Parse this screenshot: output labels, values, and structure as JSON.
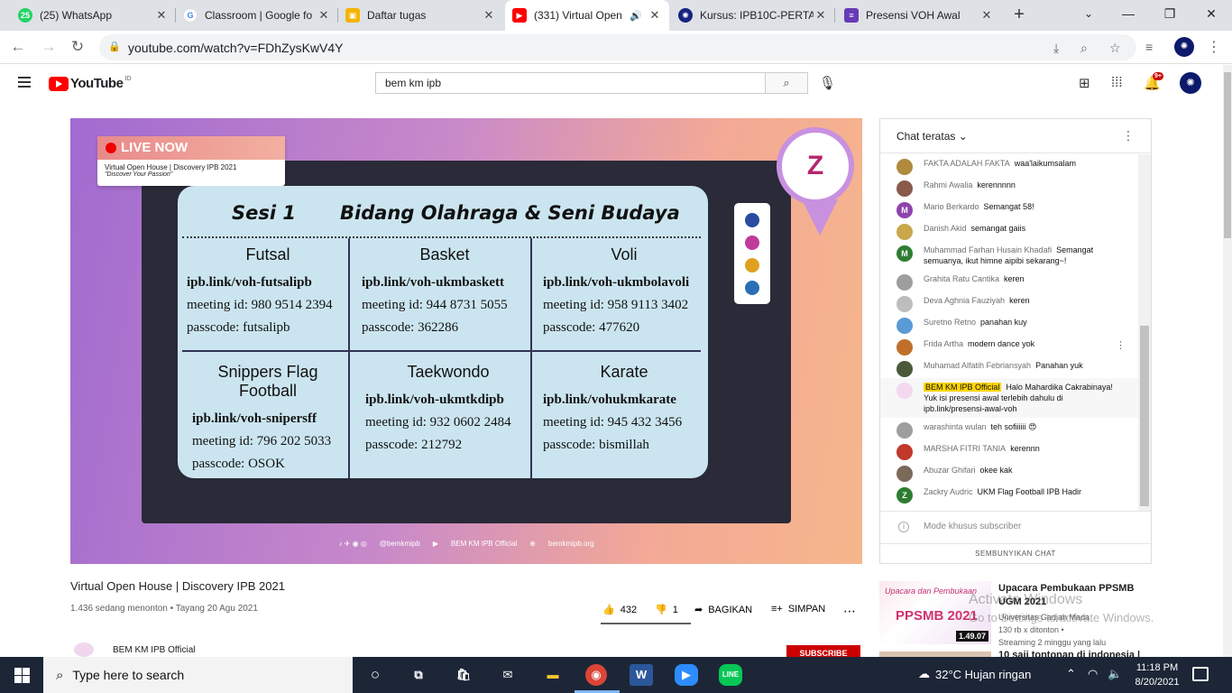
{
  "browser": {
    "tabs": [
      {
        "title": "(25) WhatsApp",
        "favicon": "whatsapp-icon",
        "badge": "25"
      },
      {
        "title": "Classroom | Google fo",
        "favicon": "google-icon"
      },
      {
        "title": "Daftar tugas",
        "favicon": "classroom-icon"
      },
      {
        "title": "(331) Virtual Open",
        "favicon": "youtube-icon",
        "active": true,
        "audio": true
      },
      {
        "title": "Kursus: IPB10C-PERTA",
        "favicon": "ipb-icon"
      },
      {
        "title": "Presensi VOH Awal",
        "favicon": "forms-icon"
      }
    ],
    "url": "youtube.com/watch?v=FDhZysKwV4Y"
  },
  "youtube": {
    "logo_text": "YouTube",
    "country_code": "ID",
    "search_value": "bem km ipb",
    "notification_badge": "9+"
  },
  "video": {
    "live_label": "LIVE NOW",
    "event_line": "Virtual Open House | Discovery IPB 2021",
    "event_tagline": "\"Discover Your Passion\"",
    "board_session": "Sesi 1",
    "board_title": "Bidang Olahraga & Seni Budaya",
    "cells": [
      {
        "name": "Futsal",
        "link": "ipb.link/voh-futsalipb",
        "meeting": "meeting id: 980 9514 2394",
        "pass": "passcode: futsalipb"
      },
      {
        "name": "Basket",
        "link": "ipb.link/voh-ukmbaskett",
        "meeting": "meeting id: 944 8731 5055",
        "pass": "passcode: 362286"
      },
      {
        "name": "Voli",
        "link": "ipb.link/voh-ukmbolavoli",
        "meeting": "meeting id: 958 9113 3402",
        "pass": "passcode: 477620"
      },
      {
        "name": "Snippers Flag Football",
        "link": "ipb.link/voh-snipersff",
        "meeting": "meeting id: 796 202 5033",
        "pass": "passcode: OSOK"
      },
      {
        "name": "Taekwondo",
        "link": "ipb.link/voh-ukmtkdipb",
        "meeting": "meeting id: 932 0602 2484",
        "pass": "passcode: 212792"
      },
      {
        "name": "Karate",
        "link": "ipb.link/vohukmkarate",
        "meeting": "meeting id: 945 432 3456",
        "pass": "passcode: bismillah"
      }
    ],
    "footer_handle": "@bemkmipb",
    "footer_channel": "BEM KM IPB Official",
    "footer_site": "bemkmipb.org",
    "title": "Virtual Open House | Discovery IPB 2021",
    "meta": "1.436 sedang menonton • Tayang 20 Agu 2021",
    "likes": "432",
    "dislikes": "1",
    "share_label": "BAGIKAN",
    "save_label": "SIMPAN",
    "channel": "BEM KM IPB Official",
    "subscribe_label": "SUBSCRIBE"
  },
  "chat": {
    "header": "Chat teratas",
    "messages": [
      {
        "author": "FAKTA ADALAH FAKTA",
        "text": "waa'laikumsalam",
        "color": "#b08a3e",
        "initial": ""
      },
      {
        "author": "Rahmi Awalia",
        "text": "kerennnnn",
        "color": "#8a5a4a",
        "initial": ""
      },
      {
        "author": "Mario Berkardo",
        "text": "Semangat 58!",
        "color": "#8e44ad",
        "initial": "M"
      },
      {
        "author": "Danish Akid",
        "text": "semangat gaiis",
        "color": "#c8a84a",
        "initial": ""
      },
      {
        "author": "Muhammad Farhan Husain Khadafi",
        "text": "Semangat semuanya, ikut himne aipibi sekarang~!",
        "color": "#2e7d32",
        "initial": "M"
      },
      {
        "author": "Grahita Ratu Cantika",
        "text": "keren",
        "color": "#9e9e9e",
        "initial": ""
      },
      {
        "author": "Deva Aghnia Fauziyah",
        "text": "keren",
        "color": "#bdbdbd",
        "initial": ""
      },
      {
        "author": "Suretno Retno",
        "text": "panahan kuy",
        "color": "#5a9bd5",
        "initial": ""
      },
      {
        "author": "Frida Artha",
        "text": "modern dance yok",
        "color": "#c0702a",
        "initial": ""
      },
      {
        "author": "Muhamad Alfatih Febriansyah",
        "text": "Panahan yuk",
        "color": "#4a5a3a",
        "initial": ""
      },
      {
        "author": "BEM KM IPB Official",
        "text": "Halo Mahardika Cakrabinaya! Yuk isi presensi awal terlebih dahulu di ipb.link/presensi-awal-voh",
        "color": "#f3d9ee",
        "initial": "",
        "owner": true
      },
      {
        "author": "warashinta wulan",
        "text": "teh sofiiiiii 😍",
        "color": "#9e9e9e",
        "initial": ""
      },
      {
        "author": "MARSHA FITRI TANIA",
        "text": "kerennn",
        "color": "#c0392b",
        "initial": ""
      },
      {
        "author": "Abuzar Ghifari",
        "text": "okee kak",
        "color": "#7a6a5a",
        "initial": ""
      },
      {
        "author": "Zackry Audric",
        "text": "UKM Flag Football IPB Hadir",
        "color": "#2e7d32",
        "initial": "Z"
      }
    ],
    "subscriber_mode": "Mode khusus subscriber",
    "hide_chat": "SEMBUNYIKAN CHAT"
  },
  "related": {
    "title": "Upacara Pembukaan PPSMB UGM 2021",
    "channel": "Universitas Gadjah Mada",
    "views": "130 rb x ditonton •",
    "age": "Streaming 2 minggu yang lalu",
    "duration": "1.49.07",
    "thumb_script": "Upacara dan Pembukaan",
    "thumb_big": "PPSMB 2021",
    "next_title": "10 saji tontonan di indonesia |"
  },
  "watermark": {
    "line1": "Activate Windows",
    "line2": "Go to Settings to activate Windows."
  },
  "taskbar": {
    "search_placeholder": "Type here to search",
    "weather": "32°C  Hujan ringan",
    "time": "11:18 PM",
    "date": "8/20/2021"
  }
}
